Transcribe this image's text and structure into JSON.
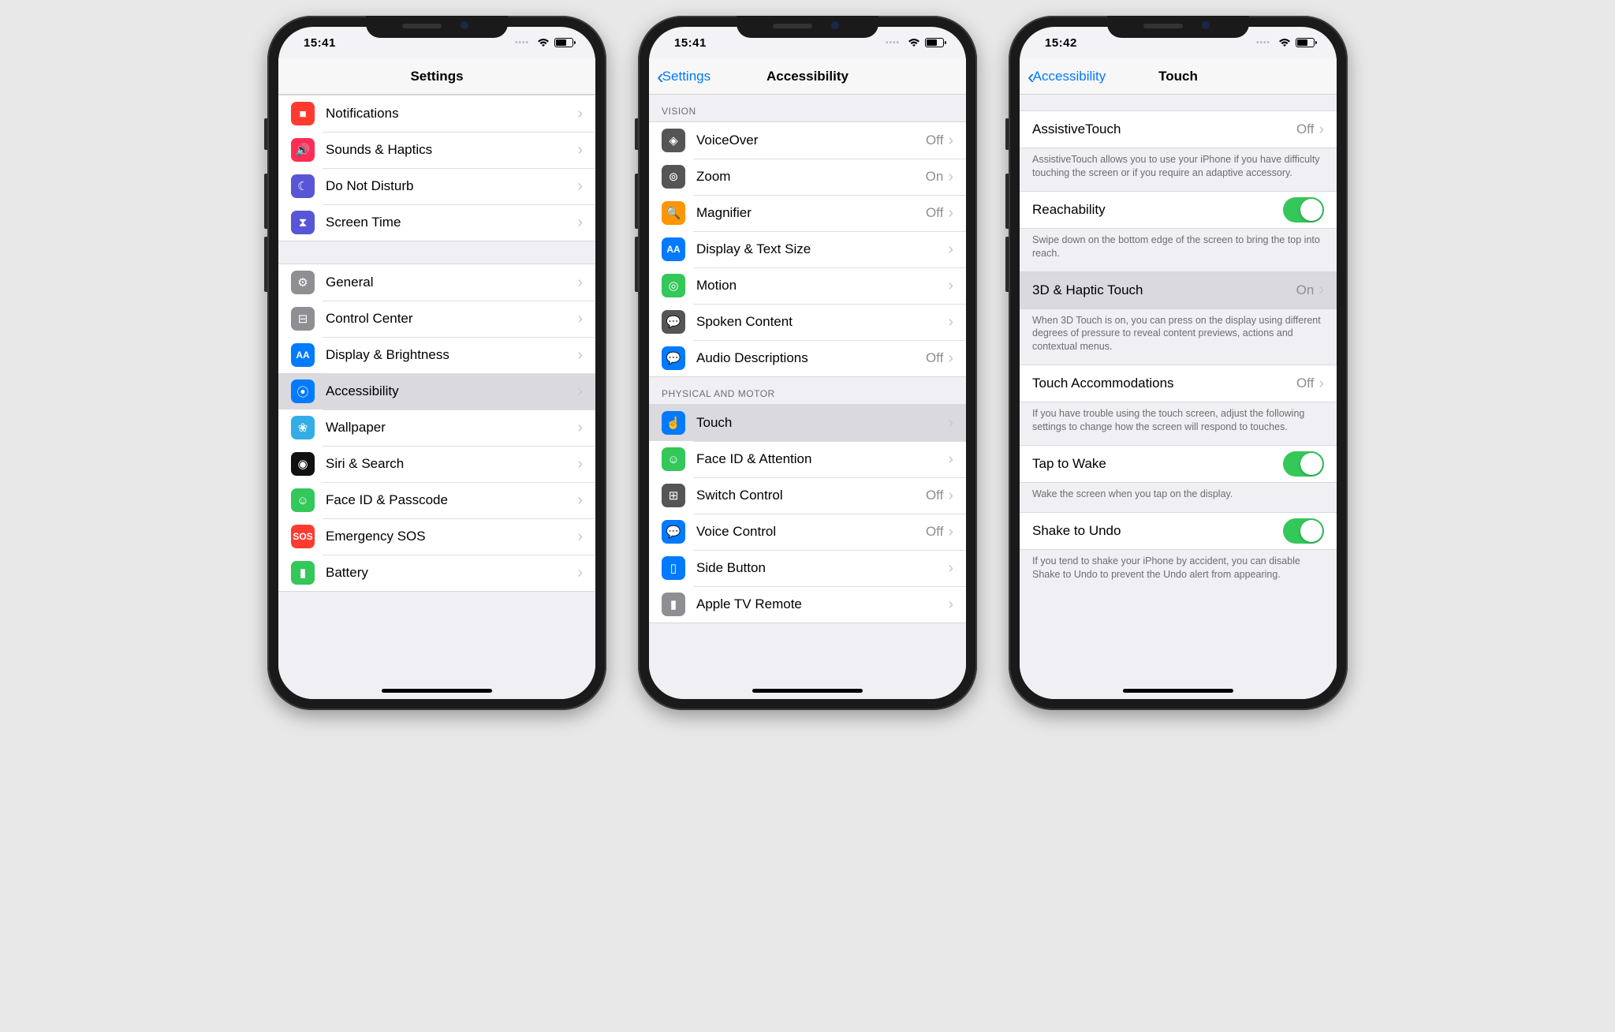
{
  "phone1": {
    "time": "15:41",
    "title": "Settings",
    "groups": [
      {
        "rows": [
          {
            "icon": "notifications-icon",
            "color": "bg-red",
            "glyph": "■",
            "label": "Notifications"
          },
          {
            "icon": "sounds-icon",
            "color": "bg-pink",
            "glyph": "🔊",
            "label": "Sounds & Haptics"
          },
          {
            "icon": "dnd-icon",
            "color": "bg-purple",
            "glyph": "☾",
            "label": "Do Not Disturb"
          },
          {
            "icon": "screentime-icon",
            "color": "bg-purple",
            "glyph": "⧗",
            "label": "Screen Time"
          }
        ]
      },
      {
        "rows": [
          {
            "icon": "general-icon",
            "color": "bg-gray",
            "glyph": "⚙",
            "label": "General"
          },
          {
            "icon": "controlcenter-icon",
            "color": "bg-gray",
            "glyph": "⊟",
            "label": "Control Center"
          },
          {
            "icon": "display-icon",
            "color": "bg-blue",
            "glyph": "AA",
            "txt": true,
            "label": "Display & Brightness"
          },
          {
            "icon": "accessibility-icon",
            "color": "bg-blue",
            "glyph": "⦿",
            "label": "Accessibility",
            "selected": true
          },
          {
            "icon": "wallpaper-icon",
            "color": "bg-teal",
            "glyph": "❀",
            "label": "Wallpaper"
          },
          {
            "icon": "siri-icon",
            "color": "bg-black",
            "glyph": "◉",
            "label": "Siri & Search"
          },
          {
            "icon": "faceid-icon",
            "color": "bg-green",
            "glyph": "☺",
            "label": "Face ID & Passcode"
          },
          {
            "icon": "sos-icon",
            "color": "bg-redsos",
            "glyph": "SOS",
            "txt": true,
            "label": "Emergency SOS"
          },
          {
            "icon": "battery-icon",
            "color": "bg-green",
            "glyph": "▮",
            "label": "Battery"
          }
        ]
      }
    ]
  },
  "phone2": {
    "time": "15:41",
    "back": "Settings",
    "title": "Accessibility",
    "sections": [
      {
        "header": "VISION",
        "rows": [
          {
            "icon": "voiceover-icon",
            "color": "bg-darkgray",
            "glyph": "◈",
            "label": "VoiceOver",
            "value": "Off"
          },
          {
            "icon": "zoom-icon",
            "color": "bg-darkgray",
            "glyph": "⊚",
            "label": "Zoom",
            "value": "On"
          },
          {
            "icon": "magnifier-icon",
            "color": "bg-orange",
            "glyph": "🔍",
            "label": "Magnifier",
            "value": "Off"
          },
          {
            "icon": "textsize-icon",
            "color": "bg-blue",
            "glyph": "AA",
            "txt": true,
            "label": "Display & Text Size"
          },
          {
            "icon": "motion-icon",
            "color": "bg-green",
            "glyph": "◎",
            "label": "Motion"
          },
          {
            "icon": "spoken-icon",
            "color": "bg-darkgray",
            "glyph": "💬",
            "label": "Spoken Content"
          },
          {
            "icon": "audiodesc-icon",
            "color": "bg-blue",
            "glyph": "💬",
            "label": "Audio Descriptions",
            "value": "Off"
          }
        ]
      },
      {
        "header": "PHYSICAL AND MOTOR",
        "rows": [
          {
            "icon": "touch-icon",
            "color": "bg-blue",
            "glyph": "☝",
            "label": "Touch",
            "selected": true
          },
          {
            "icon": "faceidatt-icon",
            "color": "bg-green",
            "glyph": "☺",
            "label": "Face ID & Attention"
          },
          {
            "icon": "switchcontrol-icon",
            "color": "bg-darkgray",
            "glyph": "⊞",
            "label": "Switch Control",
            "value": "Off"
          },
          {
            "icon": "voicecontrol-icon",
            "color": "bg-blue",
            "glyph": "💬",
            "label": "Voice Control",
            "value": "Off"
          },
          {
            "icon": "sidebutton-icon",
            "color": "bg-blue",
            "glyph": "▯",
            "label": "Side Button"
          },
          {
            "icon": "appletv-icon",
            "color": "bg-gray",
            "glyph": "▮",
            "label": "Apple TV Remote"
          }
        ]
      }
    ]
  },
  "phone3": {
    "time": "15:42",
    "back": "Accessibility",
    "title": "Touch",
    "items": [
      {
        "type": "row",
        "label": "AssistiveTouch",
        "value": "Off"
      },
      {
        "type": "footer",
        "text": "AssistiveTouch allows you to use your iPhone if you have difficulty touching the screen or if you require an adaptive accessory."
      },
      {
        "type": "switch",
        "label": "Reachability",
        "on": true
      },
      {
        "type": "footer",
        "text": "Swipe down on the bottom edge of the screen to bring the top into reach."
      },
      {
        "type": "row",
        "label": "3D & Haptic Touch",
        "value": "On",
        "selected": true
      },
      {
        "type": "footer",
        "text": "When 3D Touch is on, you can press on the display using different degrees of pressure to reveal content previews, actions and contextual menus."
      },
      {
        "type": "row",
        "label": "Touch Accommodations",
        "value": "Off"
      },
      {
        "type": "footer",
        "text": "If you have trouble using the touch screen, adjust the following settings to change how the screen will respond to touches."
      },
      {
        "type": "switch",
        "label": "Tap to Wake",
        "on": true
      },
      {
        "type": "footer",
        "text": "Wake the screen when you tap on the display."
      },
      {
        "type": "switch",
        "label": "Shake to Undo",
        "on": true
      },
      {
        "type": "footer",
        "text": "If you tend to shake your iPhone by accident, you can disable Shake to Undo to prevent the Undo alert from appearing."
      }
    ]
  }
}
